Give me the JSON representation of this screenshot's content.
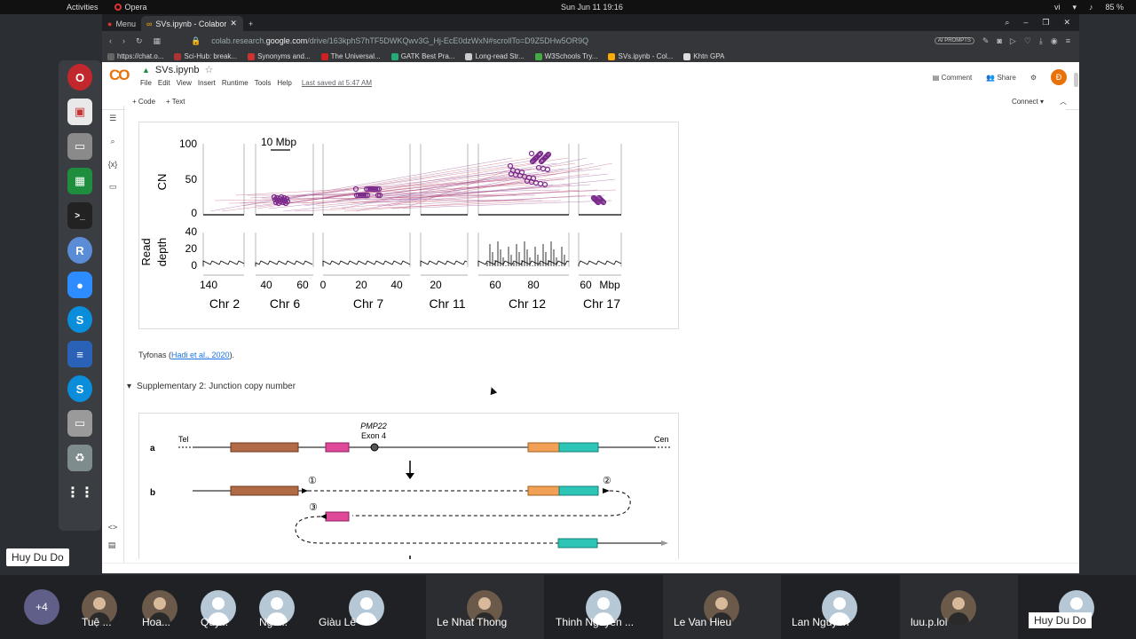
{
  "system": {
    "activities": "Activities",
    "app_name": "Opera",
    "clock": "Sun Jun 11  19:16",
    "language": "vi",
    "battery": "85 %"
  },
  "browser": {
    "tabs": [
      {
        "label": "Menu"
      },
      {
        "label": "SVs.ipynb - Colabora"
      }
    ],
    "url_prefix": "colab.research.",
    "url_domain": "google.com",
    "url_path": "/drive/163kphS7hTF5DWKQwv3G_Hj-EcE0dzWxN#scrollTo=D9Z5DHw5OR9Q",
    "ai_prompts": "AI PROMPTS",
    "bookmarks": [
      {
        "label": "https://chat.o...",
        "color": "#666"
      },
      {
        "label": "Sci-Hub: break...",
        "color": "#a33"
      },
      {
        "label": "Synonyms and...",
        "color": "#c33"
      },
      {
        "label": "The Universal...",
        "color": "#c22"
      },
      {
        "label": "GATK Best Pra...",
        "color": "#2a7"
      },
      {
        "label": "Long-read Str...",
        "color": "#ccc"
      },
      {
        "label": "W3Schools Try...",
        "color": "#4a4"
      },
      {
        "label": "SVs.ipynb - Col...",
        "color": "#f9ab00"
      },
      {
        "label": "Khtn GPA",
        "color": "#ddd"
      }
    ]
  },
  "colab": {
    "logo": "CO",
    "notebook_title": "SVs.ipynb",
    "menus": [
      "File",
      "Edit",
      "View",
      "Insert",
      "Runtime",
      "Tools",
      "Help"
    ],
    "last_saved": "Last saved at 5:47 AM",
    "comment": "Comment",
    "share": "Share",
    "avatar_letter": "Đ",
    "add_code": "+ Code",
    "add_text": "+ Text",
    "connect": "Connect"
  },
  "figure1": {
    "scale_label": "10 Mbp",
    "cn_axis": "CN",
    "cn_ticks": [
      "100",
      "50",
      "0"
    ],
    "rd_axis_line1": "Read",
    "rd_axis_line2": "depth",
    "rd_ticks": [
      "40",
      "20",
      "0"
    ],
    "x_ticks": [
      "140",
      "40",
      "60",
      "0",
      "20",
      "40",
      "20",
      "60",
      "80",
      "60",
      "Mbp"
    ],
    "chromosomes": [
      "Chr 2",
      "Chr 6",
      "Chr 7",
      "Chr 11",
      "Chr 12",
      "Chr 17"
    ]
  },
  "caption": {
    "text": "Tyfonas (",
    "link": "Hadi et al., 2020",
    "end": ")."
  },
  "section_title": "Supplementary 2: Junction copy number",
  "figure2": {
    "gene": "PMP22",
    "exon": "Exon 4",
    "tel": "Tel",
    "cen": "Cen",
    "row_a": "a",
    "row_b": "b",
    "markers": [
      "①",
      "②",
      "③"
    ]
  },
  "meet": {
    "overflow": "+4",
    "participants": [
      "Tuệ ...",
      "Hoa...",
      "Quy...",
      "Ngu...",
      "Giàu Lê",
      "Le Nhat Thong",
      "Thinh Nguyen ...",
      "Le Van Hieu",
      "Lan Nguyen",
      "luu.p.loi",
      "Huy Du Do"
    ],
    "pinned_name": "Huy Du Do"
  }
}
